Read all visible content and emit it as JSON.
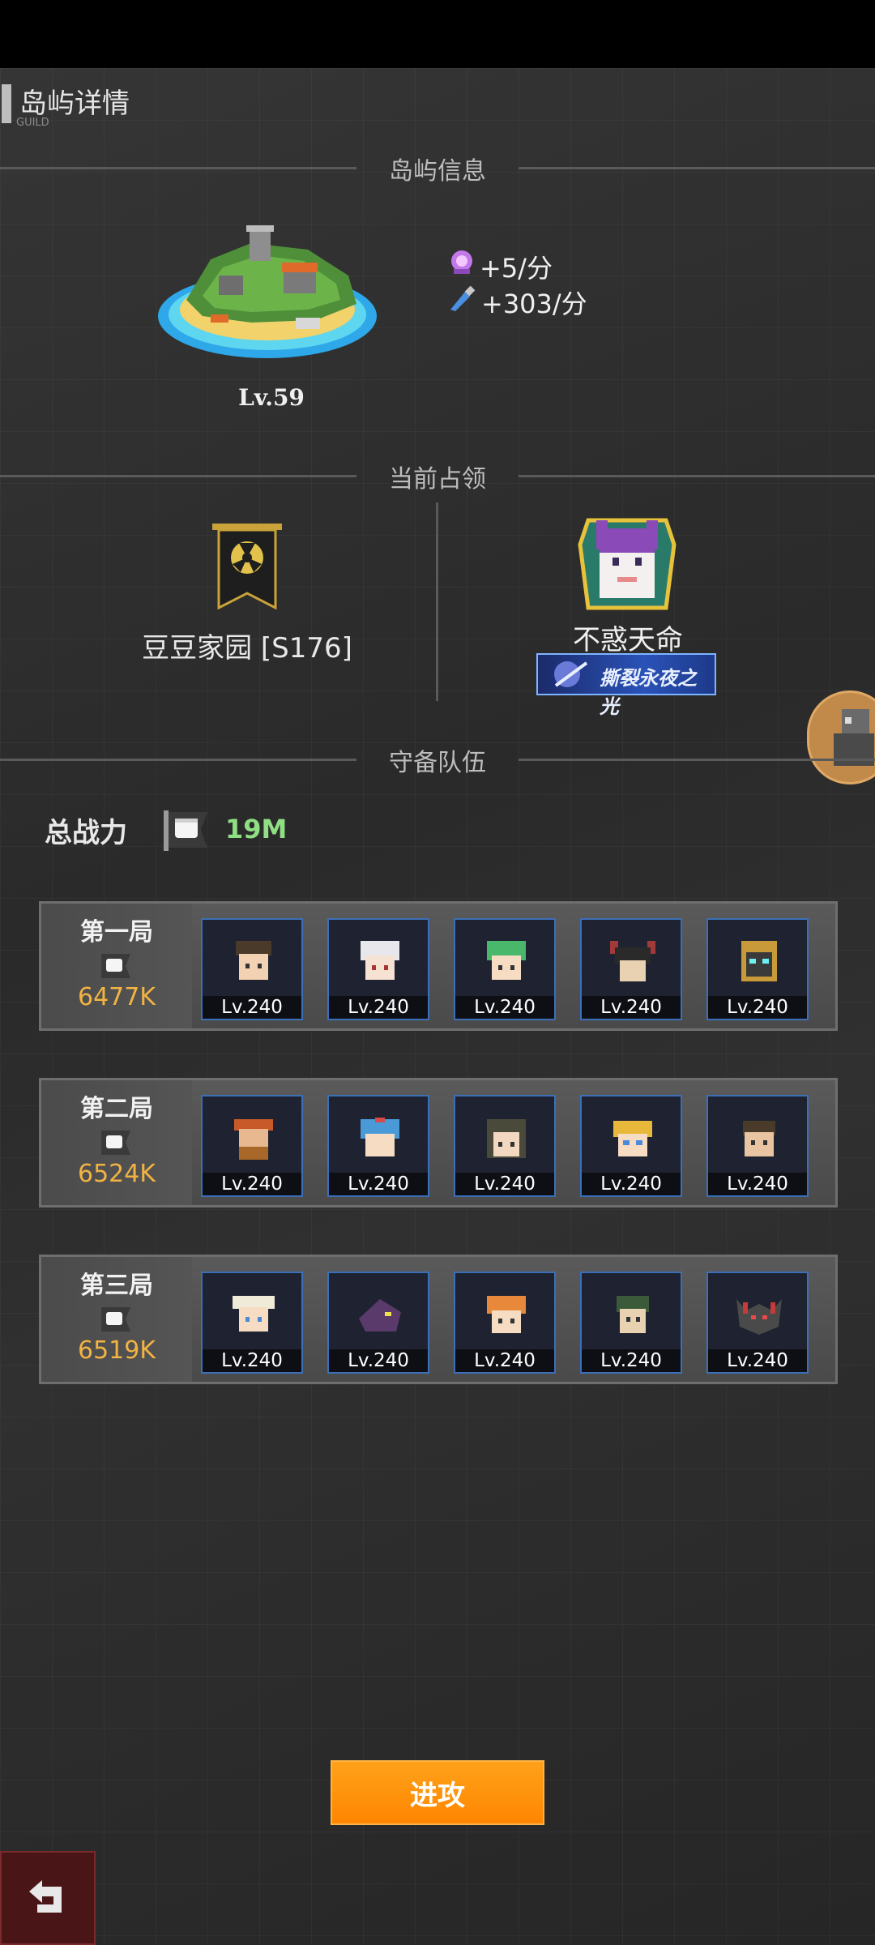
{
  "header": {
    "title": "岛屿详情",
    "subtitle": "GUILD"
  },
  "sections": {
    "island_info": "岛屿信息",
    "current_occupation": "当前占领",
    "defense_team": "守备队伍"
  },
  "island": {
    "level": "Lv.59",
    "rate_1": "+5/分",
    "rate_2": "+303/分"
  },
  "occupation": {
    "guild_name": "豆豆家园 [S176]",
    "leader_name": "不惑天命",
    "leader_title": "撕裂永夜之光"
  },
  "total_power": {
    "label": "总战力",
    "value": "19M"
  },
  "teams": [
    {
      "name": "第一局",
      "power": "6477K",
      "levels": [
        "Lv.240",
        "Lv.240",
        "Lv.240",
        "Lv.240",
        "Lv.240"
      ]
    },
    {
      "name": "第二局",
      "power": "6524K",
      "levels": [
        "Lv.240",
        "Lv.240",
        "Lv.240",
        "Lv.240",
        "Lv.240"
      ]
    },
    {
      "name": "第三局",
      "power": "6519K",
      "levels": [
        "Lv.240",
        "Lv.240",
        "Lv.240",
        "Lv.240",
        "Lv.240"
      ]
    }
  ],
  "actions": {
    "attack": "进攻"
  },
  "colors": {
    "accent": "#ff9310",
    "power": "#f2b343",
    "total_power": "#8fdf83",
    "hero_border": "#3b6fb8"
  },
  "icons": [
    "island-icon",
    "crystal-icon",
    "potion-icon",
    "guild-banner-icon",
    "leader-avatar-icon",
    "fist-icon",
    "hero-portrait-icon",
    "back-arrow-icon"
  ]
}
